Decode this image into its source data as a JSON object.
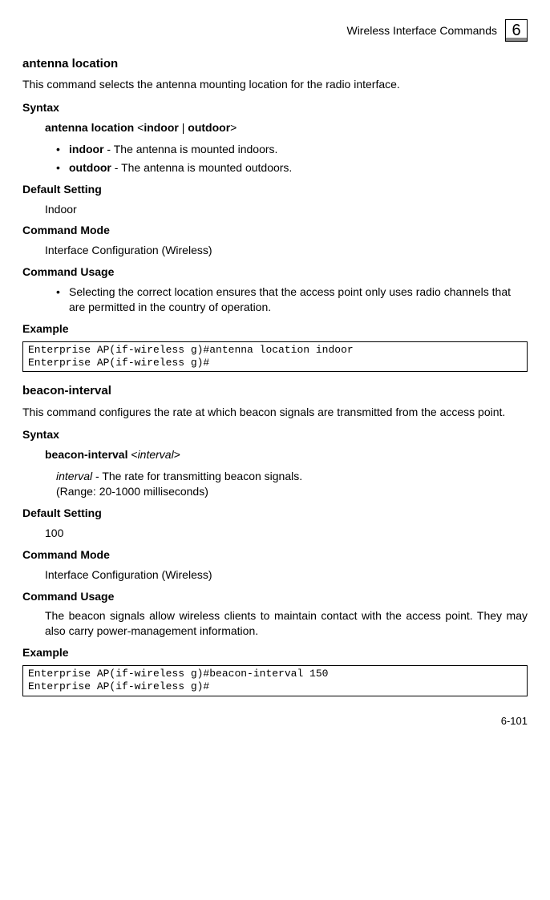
{
  "header": {
    "title": "Wireless Interface Commands",
    "chapter": "6"
  },
  "cmd1": {
    "name": "antenna location",
    "desc": "This command selects the antenna mounting location for the radio interface.",
    "syntax_label": "Syntax",
    "syntax_prefix": "antenna location ",
    "syntax_lt": "<",
    "syntax_opt1": "indoor",
    "syntax_sep": " | ",
    "syntax_opt2": "outdoor",
    "syntax_gt": ">",
    "param1_name": "indoor",
    "param1_desc": " - The antenna is mounted indoors.",
    "param2_name": "outdoor",
    "param2_desc": " - The antenna is mounted outdoors.",
    "default_label": "Default Setting",
    "default_value": "Indoor",
    "mode_label": "Command Mode",
    "mode_value": "Interface Configuration (Wireless)",
    "usage_label": "Command Usage",
    "usage_text": "Selecting the correct location ensures that the access point only uses radio channels that are permitted in the country of operation.",
    "example_label": "Example",
    "example_code": "Enterprise AP(if-wireless g)#antenna location indoor\nEnterprise AP(if-wireless g)#"
  },
  "cmd2": {
    "name": "beacon-interval",
    "desc": "This command configures the rate at which beacon signals are transmitted from the access point.",
    "syntax_label": "Syntax",
    "syntax_prefix": "beacon-interval ",
    "syntax_lt": "<",
    "syntax_arg": "interval",
    "syntax_gt": ">",
    "arg_name": "interval",
    "arg_desc": " - The rate for transmitting beacon signals.",
    "arg_range": "(Range: 20-1000 milliseconds)",
    "default_label": "Default Setting",
    "default_value": "100",
    "mode_label": "Command Mode",
    "mode_value": "Interface Configuration (Wireless)",
    "usage_label": "Command Usage",
    "usage_text": "The beacon signals allow wireless clients to maintain contact with the access point. They may also carry power-management information.",
    "example_label": "Example",
    "example_code": "Enterprise AP(if-wireless g)#beacon-interval 150\nEnterprise AP(if-wireless g)#"
  },
  "footer": {
    "page": "6-101"
  }
}
